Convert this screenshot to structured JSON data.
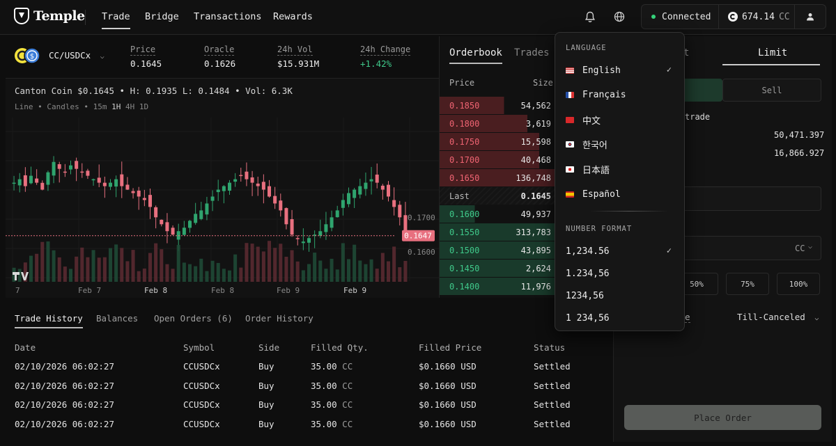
{
  "app": {
    "name": "Temple"
  },
  "nav": {
    "items": [
      "Trade",
      "Bridge",
      "Transactions",
      "Rewards"
    ],
    "active": "Trade"
  },
  "header": {
    "status": "Connected",
    "balance_value": "674.14",
    "balance_unit": "CC"
  },
  "market": {
    "pair": "CC/USDCx",
    "stats": [
      {
        "label": "Price",
        "value": "0.1645"
      },
      {
        "label": "Oracle",
        "value": "0.1626"
      },
      {
        "label": "24h Vol",
        "value": "$15.931M"
      },
      {
        "label": "24h Change",
        "value": "+1.42%"
      }
    ]
  },
  "chart": {
    "ohlc_line": "Canton Coin $0.1645 • H: 0.1935 L: 0.1484 • Vol: 6.3K",
    "modes": [
      "Line",
      "Candles"
    ],
    "intervals": [
      "15m",
      "1H",
      "4H",
      "1D"
    ],
    "active_interval": "1H",
    "price_tag": "0.1647",
    "colors": {
      "up": "#2fa46e",
      "down": "#e8707f"
    }
  },
  "chart_data": {
    "type": "candlestick",
    "y_ticks": [
      "0.1700",
      "0.1600"
    ],
    "x_ticks": [
      "7",
      "Feb 7",
      "Feb 8",
      "Feb 8",
      "Feb 9",
      "Feb 9"
    ],
    "current_price": 0.1647,
    "ylim": [
      0.155,
      0.198
    ]
  },
  "orderbook": {
    "tabs": [
      "Orderbook",
      "Trades"
    ],
    "headers": [
      "Price",
      "Size"
    ],
    "asks": [
      {
        "price": "0.1850",
        "size": "54,562",
        "depth": 0.55
      },
      {
        "price": "0.1800",
        "size": "3,619",
        "depth": 0.75
      },
      {
        "price": "0.1750",
        "size": "15,598",
        "depth": 0.85
      },
      {
        "price": "0.1700",
        "size": "40,468",
        "depth": 0.85
      },
      {
        "price": "0.1650",
        "size": "136,748",
        "depth": 1.0
      }
    ],
    "last_label": "Last",
    "last_price": "0.1645",
    "bids": [
      {
        "price": "0.1600",
        "size": "49,937",
        "depth": 0.3
      },
      {
        "price": "0.1550",
        "size": "313,783",
        "depth": 1.0
      },
      {
        "price": "0.1500",
        "size": "43,895",
        "depth": 1.0
      },
      {
        "price": "0.1450",
        "size": "2,624",
        "depth": 1.0
      },
      {
        "price": "0.1400",
        "size": "11,976",
        "depth": 1.0
      }
    ]
  },
  "order_form": {
    "tabs": [
      "t",
      "Limit"
    ],
    "sides": [
      "Sell"
    ],
    "avail_label": "trade",
    "values": [
      "50,471.397",
      "16,866.927"
    ],
    "unit": "CC",
    "pcts": [
      "50%",
      "75%",
      "100%"
    ],
    "tif_label": "e",
    "tif_value": "Till-Canceled",
    "place_label": "Place Order"
  },
  "history": {
    "tabs": [
      "Trade History",
      "Balances",
      "Open Orders (6)",
      "Order History"
    ],
    "headers": [
      "Date",
      "Symbol",
      "Side",
      "Filled Qty.",
      "Filled Price",
      "Status"
    ],
    "rows": [
      [
        "02/10/2026 06:02:27",
        "CCUSDCx",
        "Buy",
        "35.00",
        "$0.1660",
        "Settled"
      ],
      [
        "02/10/2026 06:02:27",
        "CCUSDCx",
        "Buy",
        "35.00",
        "$0.1660",
        "Settled"
      ],
      [
        "02/10/2026 06:02:27",
        "CCUSDCx",
        "Buy",
        "35.00",
        "$0.1660",
        "Settled"
      ],
      [
        "02/10/2026 06:02:27",
        "CCUSDCx",
        "Buy",
        "35.00",
        "$0.1660",
        "Settled"
      ]
    ],
    "qty_unit": "CC",
    "price_unit": "USD"
  },
  "dropdown": {
    "language_title": "LANGUAGE",
    "languages": [
      {
        "label": "English",
        "flag": "us",
        "selected": true
      },
      {
        "label": "Français",
        "flag": "fr",
        "selected": false
      },
      {
        "label": "中文",
        "flag": "cn",
        "selected": false
      },
      {
        "label": "한국어",
        "flag": "kr",
        "selected": false
      },
      {
        "label": "日本語",
        "flag": "jp",
        "selected": false
      },
      {
        "label": "Español",
        "flag": "es",
        "selected": false
      }
    ],
    "number_title": "NUMBER FORMAT",
    "formats": [
      {
        "label": "1,234.56",
        "selected": true
      },
      {
        "label": "1.234,56",
        "selected": false
      },
      {
        "label": "1234,56",
        "selected": false
      },
      {
        "label": "1 234,56",
        "selected": false
      }
    ],
    "check_glyph": "✓"
  }
}
